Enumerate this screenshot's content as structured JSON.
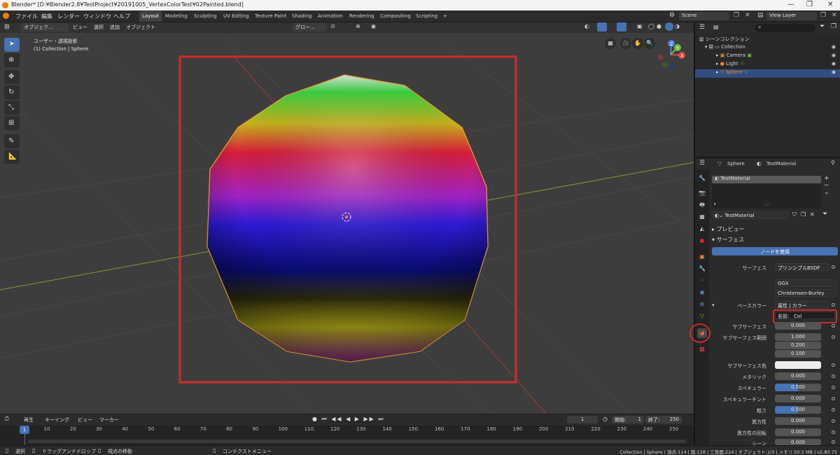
{
  "titlebar": {
    "title": "Blender* [D:¥Blender2.8¥TestProject¥20191005_VertexColorTest¥02Painted.blend]",
    "minimize": "—",
    "maximize": "❐",
    "close": "✕"
  },
  "menu": {
    "items": [
      "ファイル",
      "編集",
      "レンダー",
      "ウィンドウ",
      "ヘルプ"
    ]
  },
  "workspaces": [
    "Layout",
    "Modeling",
    "Sculpting",
    "UV Editing",
    "Texture Paint",
    "Shading",
    "Animation",
    "Rendering",
    "Compositing",
    "Scripting",
    "+"
  ],
  "scene": {
    "name": "Scene",
    "view_layer": "View Layer"
  },
  "viewport": {
    "mode": "オブジェク...",
    "menus": [
      "ビュー",
      "選択",
      "追加",
      "オブジェクト"
    ],
    "transform": "グロー...",
    "info_line1": "ユーザー・透視投影",
    "info_line2": "(1) Collection | Sphere"
  },
  "gizmo": {
    "x": "X",
    "y": "Y",
    "z": "Z"
  },
  "outliner": {
    "title": "シーンコレクション",
    "items": [
      {
        "name": "Collection",
        "color": "#d8d8d8"
      },
      {
        "name": "Camera",
        "color": "#d8d8d8"
      },
      {
        "name": "Light",
        "color": "#d8d8d8"
      },
      {
        "name": "Sphere",
        "color": "#e88b3c"
      }
    ]
  },
  "properties": {
    "object": "Sphere",
    "material": "TestMaterial",
    "slot": "TestMaterial",
    "slot_footer": "::::",
    "datablock": "TestMaterial",
    "panels": {
      "preview": "プレビュー",
      "surface": "サーフェス"
    },
    "use_nodes": "ノードを使用",
    "fields": {
      "surface_label": "サーフェス",
      "surface_value": "プリンシプルBSDF",
      "distribution": "GGX",
      "subsurface_method": "Christensen-Burley",
      "base_color_label": "ベースカラー",
      "base_color_value": "属性 | カラー",
      "name_label": "名前:",
      "name_value": "Col",
      "subsurface_label": "サブサーフェス",
      "subsurface_value": "0.000",
      "subsurface_radius_label": "サブサーフェス範囲",
      "subsurface_radius": [
        "1.000",
        "0.200",
        "0.100"
      ],
      "subsurface_color_label": "サブサーフェス色",
      "metallic_label": "メタリック",
      "metallic_value": "0.000",
      "specular_label": "スペキュラー",
      "specular_value": "0.500",
      "specular_tint_label": "スペキュラーチント",
      "specular_tint_value": "0.000",
      "roughness_label": "粗さ",
      "roughness_value": "0.500",
      "anisotropic_label": "異方性",
      "anisotropic_value": "0.000",
      "anisotropic_rotation_label": "異方性の回転",
      "anisotropic_rotation_value": "0.000",
      "sheen_label": "シーン",
      "sheen_value": "0.000"
    }
  },
  "timeline": {
    "menus": [
      "再生",
      "キーイング",
      "ビュー",
      "マーカー"
    ],
    "current": "1",
    "start_label": "開始:",
    "start": "1",
    "end_label": "終了:",
    "end": "250",
    "ticks": [
      "1",
      "10",
      "20",
      "30",
      "40",
      "50",
      "60",
      "70",
      "80",
      "90",
      "100",
      "110",
      "120",
      "130",
      "140",
      "150",
      "160",
      "170",
      "180",
      "190",
      "200",
      "210",
      "220",
      "230",
      "240",
      "250"
    ]
  },
  "statusbar": {
    "select": "選択",
    "drag": "ドラッグアンドドロップ",
    "move": "視点の移動",
    "context": "コンテクストメニュー",
    "stats": "Collection | Sphere | 頂点:114 | 面:128 | 三角面:224 | オブジェクト:1/3 | メモリ:50.5 MB | v2.80.75"
  },
  "colors": {
    "accent": "#4772b3",
    "highlight_red": "#d12a2a",
    "selected_orange": "#e88b3c",
    "bg": "#3d3d3d"
  }
}
